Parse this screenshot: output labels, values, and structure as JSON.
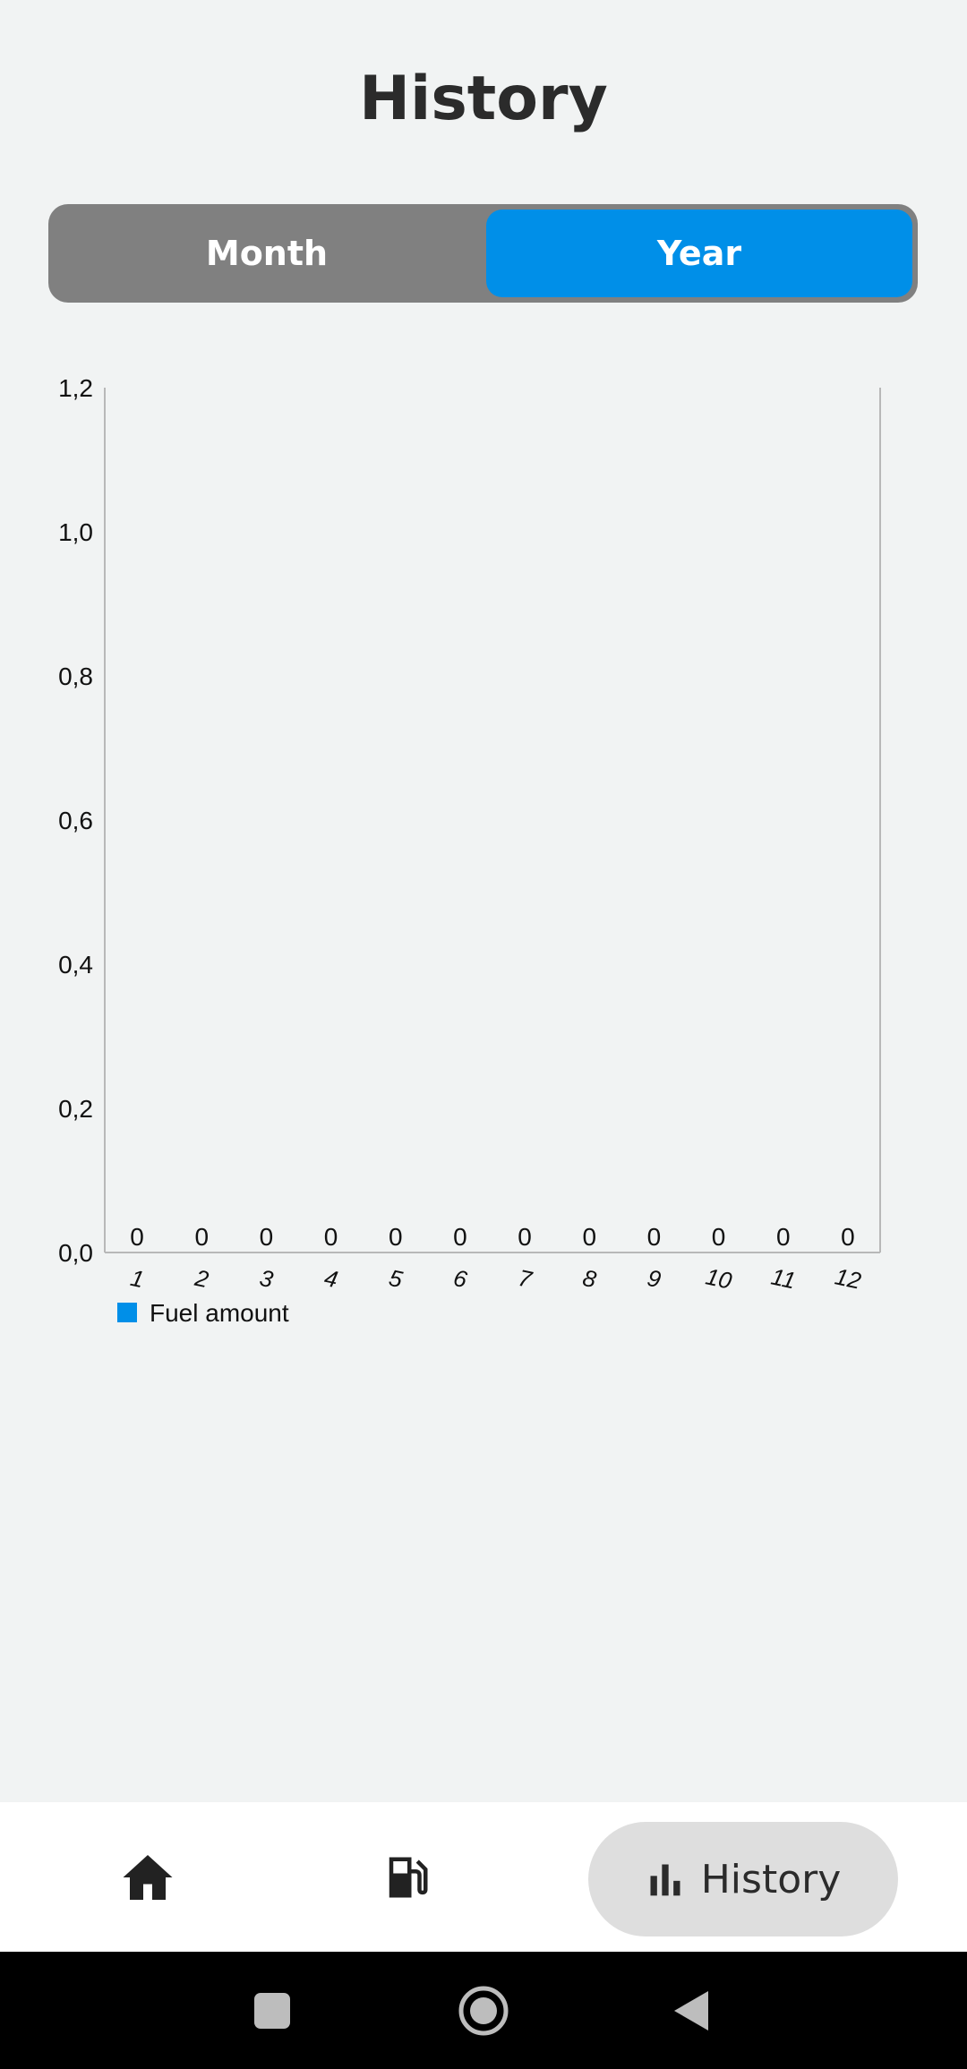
{
  "header": {
    "title": "History"
  },
  "segmented": {
    "options": [
      "Month",
      "Year"
    ],
    "selected": "Year"
  },
  "chart_data": {
    "type": "bar",
    "categories": [
      "1",
      "2",
      "3",
      "4",
      "5",
      "6",
      "7",
      "8",
      "9",
      "10",
      "11",
      "12"
    ],
    "series": [
      {
        "name": "Fuel amount",
        "values": [
          0,
          0,
          0,
          0,
          0,
          0,
          0,
          0,
          0,
          0,
          0,
          0
        ],
        "color": "#008fe8"
      }
    ],
    "y_ticks": [
      "0,0",
      "0,2",
      "0,4",
      "0,6",
      "0,8",
      "1,0",
      "1,2"
    ],
    "ylim": [
      0,
      1.2
    ],
    "data_labels": [
      "0",
      "0",
      "0",
      "0",
      "0",
      "0",
      "0",
      "0",
      "0",
      "0",
      "0",
      "0"
    ],
    "legend": {
      "label": "Fuel amount",
      "color": "#008fe8",
      "placement": "bottom-left"
    }
  },
  "bottom_nav": {
    "items": [
      {
        "icon": "home-icon"
      },
      {
        "icon": "fuel-pump-icon"
      },
      {
        "icon": "bar-chart-icon",
        "label": "History"
      }
    ],
    "active": "History"
  },
  "system_nav": {
    "icons": [
      "recents-icon",
      "home-circle-icon",
      "back-icon"
    ]
  },
  "colors": {
    "accent": "#008fe8",
    "toggle_bg": "#808080",
    "page_bg": "#f1f3f3",
    "active_pill": "#dedede"
  }
}
